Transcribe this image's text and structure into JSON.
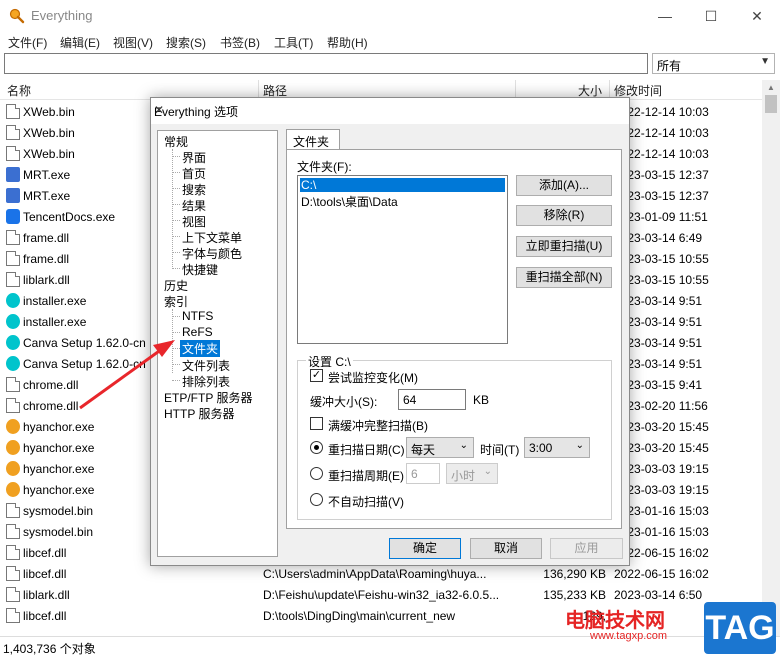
{
  "app": {
    "title": "Everything"
  },
  "menu": [
    "文件(F)",
    "编辑(E)",
    "视图(V)",
    "搜索(S)",
    "书签(B)",
    "工具(T)",
    "帮助(H)"
  ],
  "search": {
    "value": ""
  },
  "filter": {
    "selected": "所有"
  },
  "columns": {
    "name": "名称",
    "path": "路径",
    "size": "大小",
    "date": "修改时间"
  },
  "rows": [
    {
      "name": "XWeb.bin",
      "icon": "file-icon",
      "path": "",
      "size": "",
      "date": "2022-12-14 10:03"
    },
    {
      "name": "XWeb.bin",
      "icon": "file-icon",
      "path": "",
      "size": "",
      "date": "2022-12-14 10:03"
    },
    {
      "name": "XWeb.bin",
      "icon": "file-icon",
      "path": "",
      "size": "",
      "date": "2022-12-14 10:03"
    },
    {
      "name": "MRT.exe",
      "icon": "exe-icon",
      "path": "",
      "size": "",
      "date": "2023-03-15 12:37"
    },
    {
      "name": "MRT.exe",
      "icon": "exe-icon",
      "path": "",
      "size": "",
      "date": "2023-03-15 12:37"
    },
    {
      "name": "TencentDocs.exe",
      "icon": "tencent-docs-icon",
      "path": "",
      "size": "",
      "date": "2023-01-09 11:51"
    },
    {
      "name": "frame.dll",
      "icon": "file-icon",
      "path": "",
      "size": "",
      "date": "2023-03-14 6:49"
    },
    {
      "name": "frame.dll",
      "icon": "file-icon",
      "path": "",
      "size": "",
      "date": "2023-03-15 10:55"
    },
    {
      "name": "liblark.dll",
      "icon": "file-icon",
      "path": "",
      "size": "",
      "date": "2023-03-15 10:55"
    },
    {
      "name": "installer.exe",
      "icon": "canva-icon",
      "path": "",
      "size": "",
      "date": "2023-03-14 9:51"
    },
    {
      "name": "installer.exe",
      "icon": "canva-icon",
      "path": "",
      "size": "",
      "date": "2023-03-14 9:51"
    },
    {
      "name": "Canva Setup 1.62.0-cn",
      "icon": "canva-icon",
      "path": "",
      "size": "",
      "date": "2023-03-14 9:51"
    },
    {
      "name": "Canva Setup 1.62.0-cn",
      "icon": "canva-icon",
      "path": "",
      "size": "",
      "date": "2023-03-14 9:51"
    },
    {
      "name": "chrome.dll",
      "icon": "file-icon",
      "path": "",
      "size": "",
      "date": "2023-03-15 9:41"
    },
    {
      "name": "chrome.dll",
      "icon": "file-icon",
      "path": "",
      "size": "",
      "date": "2023-02-20 11:56"
    },
    {
      "name": "hyanchor.exe",
      "icon": "hyanchor-icon",
      "path": "",
      "size": "",
      "date": "2023-03-20 15:45"
    },
    {
      "name": "hyanchor.exe",
      "icon": "hyanchor-icon",
      "path": "",
      "size": "",
      "date": "2023-03-20 15:45"
    },
    {
      "name": "hyanchor.exe",
      "icon": "hyanchor-icon",
      "path": "",
      "size": "",
      "date": "2023-03-03 19:15"
    },
    {
      "name": "hyanchor.exe",
      "icon": "hyanchor-icon",
      "path": "",
      "size": "",
      "date": "2023-03-03 19:15"
    },
    {
      "name": "sysmodel.bin",
      "icon": "file-icon",
      "path": "",
      "size": "",
      "date": "2023-01-16 15:03"
    },
    {
      "name": "sysmodel.bin",
      "icon": "file-icon",
      "path": "",
      "size": "",
      "date": "2023-01-16 15:03"
    },
    {
      "name": "libcef.dll",
      "icon": "file-icon",
      "path": "",
      "size": "",
      "date": "2022-06-15 16:02"
    },
    {
      "name": "libcef.dll",
      "icon": "file-icon",
      "path": "C:\\Users\\admin\\AppData\\Roaming\\huya...",
      "size": "136,290 KB",
      "date": "2022-06-15 16:02"
    },
    {
      "name": "liblark.dll",
      "icon": "file-icon",
      "path": "D:\\Feishu\\update\\Feishu-win32_ia32-6.0.5...",
      "size": "135,233 KB",
      "date": "2023-03-14 6:50"
    },
    {
      "name": "libcef.dll",
      "icon": "file-icon",
      "path": "D:\\tools\\DingDing\\main\\current_new",
      "size": "129,",
      "date": ""
    }
  ],
  "status": {
    "count": "1,403,736 个对象"
  },
  "dialog": {
    "title": "Everything 选项",
    "tree": {
      "general": "常规",
      "general_children": [
        "界面",
        "首页",
        "搜索",
        "结果",
        "视图",
        "上下文菜单",
        "字体与颜色",
        "快捷键"
      ],
      "history": "历史",
      "index": "索引",
      "index_children": [
        "NTFS",
        "ReFS",
        "文件夹",
        "文件列表",
        "排除列表"
      ],
      "etp": "ETP/FTP 服务器",
      "http": "HTTP 服务器"
    },
    "tab": "文件夹",
    "folders_label": "文件夹(F):",
    "folders": [
      "C:\\",
      "D:\\tools\\桌面\\Data"
    ],
    "buttons": {
      "add": "添加(A)...",
      "remove": "移除(R)",
      "rescan_now": "立即重扫描(U)",
      "rescan_all": "重扫描全部(N)"
    },
    "settings": {
      "title": "设置 C:\\",
      "monitor_label": "尝试监控变化(M)",
      "monitor_checked": true,
      "buffer_label": "缓冲大小(S):",
      "buffer_value": "64",
      "buffer_unit": "KB",
      "full_buffer_label": "满缓冲完整扫描(B)",
      "full_buffer_checked": false,
      "rescan_date_label": "重扫描日期(C)",
      "rescan_date_value": "每天",
      "time_label": "时间(T)",
      "time_value": "3:00",
      "rescan_period_label": "重扫描周期(E)",
      "period_value": "6",
      "period_unit": "小时",
      "no_auto_label": "不自动扫描(V)",
      "selected_mode": "rescan_date"
    },
    "ok": "确定",
    "cancel": "取消",
    "apply": "应用"
  },
  "watermark": {
    "site": "电脑技术网",
    "url": "www.tagxp.com",
    "tag": "TAG"
  },
  "colors": {
    "accent": "#0078d7",
    "arrow": "#e8262b",
    "tag_blue": "#1b76d0"
  }
}
